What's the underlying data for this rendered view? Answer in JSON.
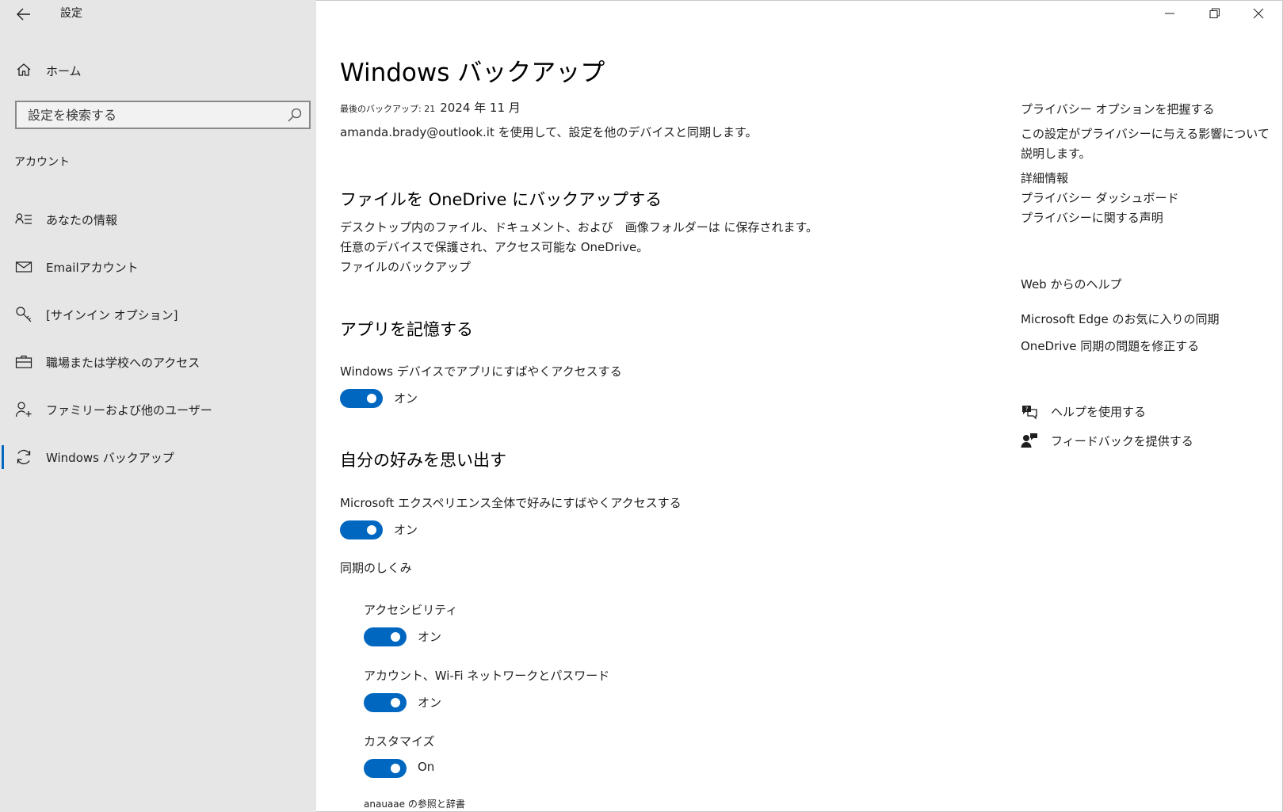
{
  "window": {
    "title": "設定"
  },
  "sidebar": {
    "home": "ホーム",
    "search": {
      "placeholder": "設定を検索する"
    },
    "section": "アカウント",
    "items": [
      {
        "label": "あなたの情報",
        "icon": "person-list-icon"
      },
      {
        "label": "Emailアカウント",
        "icon": "mail-icon"
      },
      {
        "label": "[サインイン オプション]",
        "icon": "key-icon"
      },
      {
        "label": "職場または学校へのアクセス",
        "icon": "briefcase-icon"
      },
      {
        "label": "ファミリーおよび他のユーザー",
        "icon": "person-add-icon"
      },
      {
        "label": "Windows バックアップ",
        "icon": "sync-icon",
        "active": true
      }
    ]
  },
  "main": {
    "title": "Windows バックアップ",
    "last_backup_label": "最後のバックアップ: 21",
    "last_backup_date": "2024 年 11 月",
    "sync_line": "amanda.brady@outlook.it を使用して、設定を他のデバイスと同期します。",
    "onedrive": {
      "heading": "ファイルを OneDrive にバックアップする",
      "line1": "デスクトップ内のファイル、ドキュメント、および　画像フォルダーは に保存されます。",
      "line2": "任意のデバイスで保護され、アクセス可能な OneDrive。",
      "link": "ファイルのバックアップ"
    },
    "apps": {
      "heading": "アプリを記憶する",
      "label": "Windows デバイスでアプリにすばやくアクセスする",
      "state": "オン"
    },
    "prefs": {
      "heading": "自分の好みを思い出す",
      "label": "Microsoft エクスペリエンス全体で好みにすばやくアクセスする",
      "state": "オン",
      "how": "同期のしくみ",
      "sub": [
        {
          "label": "アクセシビリティ",
          "state": "オン"
        },
        {
          "label": "アカウント、Wi-Fi ネットワークとパスワード",
          "state": "オン"
        },
        {
          "label": "カスタマイズ",
          "state": "On"
        }
      ],
      "bottom": "anauaae の参照と辞書"
    }
  },
  "right": {
    "privacy_title": "プライバシー オプションを把握する",
    "privacy_desc_1": "この設定がプライバシーに与える影響について",
    "privacy_desc_2": "説明します。",
    "links": [
      "詳細情報",
      "プライバシー ダッシュボード",
      "プライバシーに関する声明"
    ],
    "web_help": "Web からのヘルプ",
    "help_links": [
      "Microsoft Edge のお気に入りの同期",
      "OneDrive 同期の問題を修正する"
    ],
    "get_help": "ヘルプを使用する",
    "feedback": "フィードバックを提供する"
  },
  "colors": {
    "accent": "#0067c0",
    "sidebar_bg": "#e6e6e6"
  }
}
